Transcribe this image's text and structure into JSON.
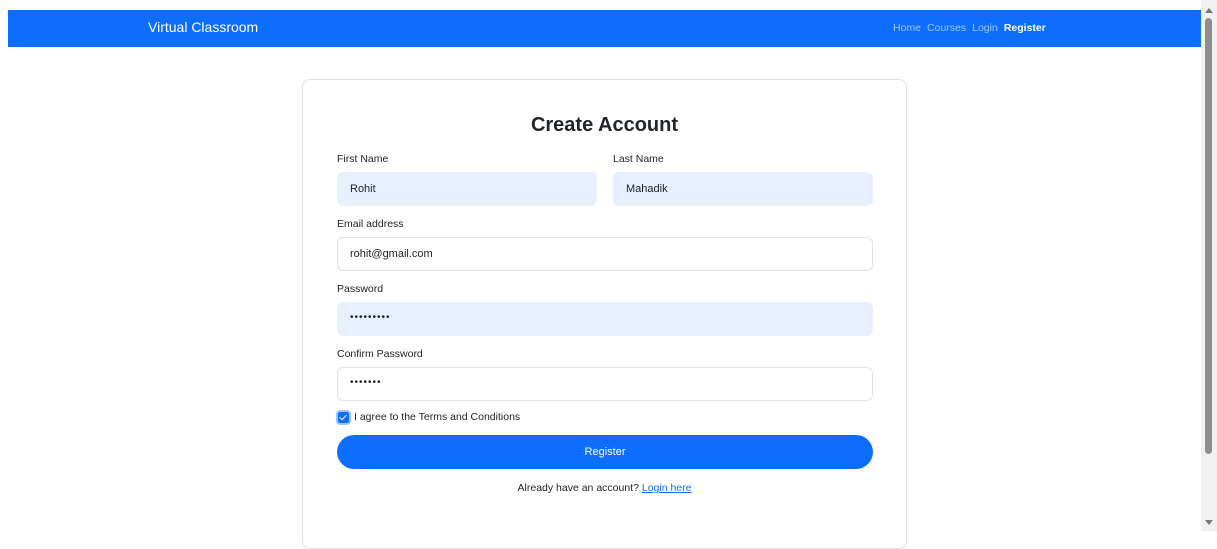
{
  "navbar": {
    "brand": "Virtual Classroom",
    "links": [
      {
        "label": "Home",
        "active": false
      },
      {
        "label": "Courses",
        "active": false
      },
      {
        "label": "Login",
        "active": false
      },
      {
        "label": "Register",
        "active": true
      }
    ]
  },
  "form": {
    "title": "Create Account",
    "first_name": {
      "label": "First Name",
      "value": "Rohit"
    },
    "last_name": {
      "label": "Last Name",
      "value": "Mahadik"
    },
    "email": {
      "label": "Email address",
      "value": "rohit@gmail.com"
    },
    "password": {
      "label": "Password",
      "value": "•••••••••"
    },
    "confirm_password": {
      "label": "Confirm Password",
      "value": "•••••••"
    },
    "terms": {
      "label": "I agree to the Terms and Conditions",
      "checked": true
    },
    "submit_label": "Register",
    "footer_prefix": "Already have an account?",
    "footer_link": "Login here"
  },
  "colors": {
    "primary": "#0d6efd",
    "autofill": "#e8f0fe"
  }
}
